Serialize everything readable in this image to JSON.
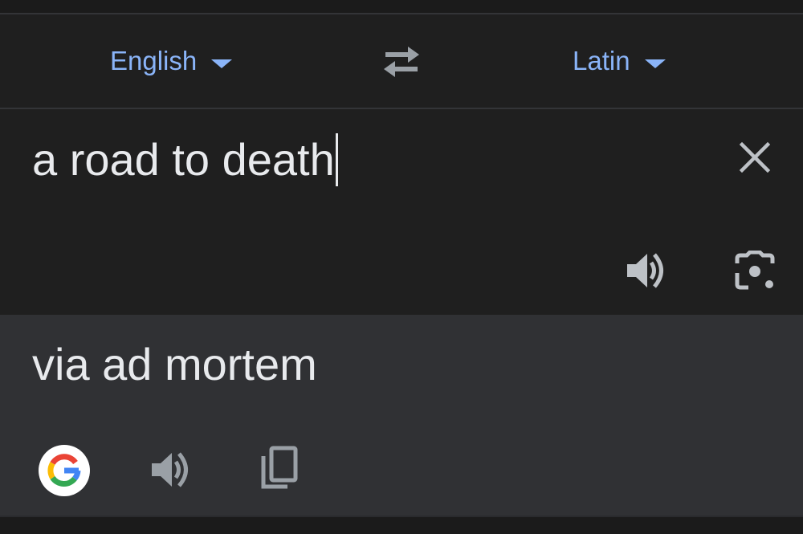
{
  "languages": {
    "source": "English",
    "target": "Latin"
  },
  "input": {
    "text": "a road to death"
  },
  "output": {
    "text": "via ad mortem"
  },
  "icons": {
    "dropdown": "chevron-down-icon",
    "swap": "swap-arrows-icon",
    "clear": "close-icon",
    "speaker": "speaker-icon",
    "camera": "camera-icon",
    "google": "google-logo-icon",
    "copy": "copy-icon"
  },
  "colors": {
    "accent": "#8ab4f8",
    "background": "#1f1f1f",
    "output_background": "#303134",
    "text": "#e8eaed",
    "icon": "#bdc1c6"
  }
}
